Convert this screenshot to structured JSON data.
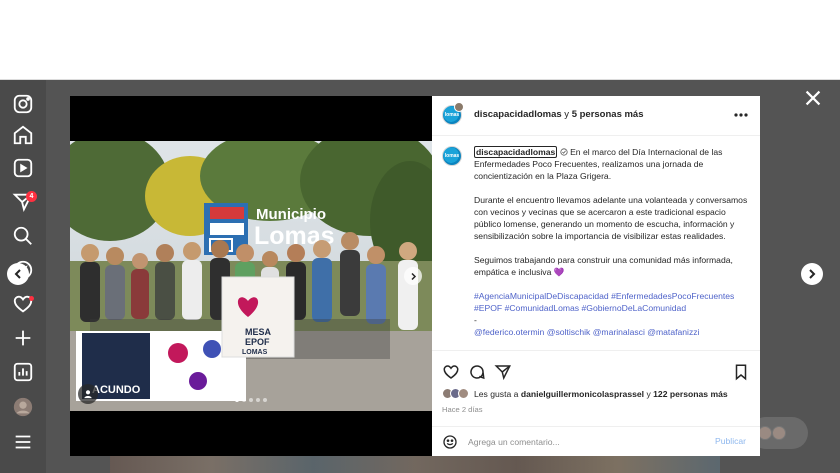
{
  "post": {
    "author": "discapacidadlomas",
    "header_and": "y",
    "header_others": "5 personas más",
    "avatar_text": "lomas",
    "caption_user": "discapacidadlomas",
    "caption_paragraphs": [
      "En el marco del Día Internacional de las Enfermedades Poco Frecuentes, realizamos una jornada de concientización en la Plaza Grigera.",
      "Durante el encuentro llevamos adelante una volanteada y conversamos con vecinos y vecinas que se acercaron a este tradicional espacio público lomense, generando un momento de escucha, información y sensibilización sobre la importancia de visibilizar estas realidades.",
      "Seguimos trabajando para construir una comunidad más informada, empática e inclusiva"
    ],
    "caption_heart": "💜",
    "hashtags": "#AgenciaMunicipalDeDiscapacidad #EnfermedadesPocoFrecuentes #EPOF #ComunidadLomas #GobiernoDeLaComunidad",
    "dash": "-",
    "tagged_partial": "@federico.otermin @soltischik @marinalasci @matafanizzi"
  },
  "likes": {
    "prefix": "Les gusta a",
    "user": "danielguillermonicolasprassel",
    "and": "y",
    "others": "122 personas más"
  },
  "timestamp": "Hace 2 días",
  "comment": {
    "placeholder": "Agrega un comentario...",
    "post_label": "Publicar"
  },
  "photo_signs": {
    "sign_municipio": "Municipio",
    "sign_lomas": "Lomas",
    "banner_mesa": "MESA",
    "banner_epof": "EPOF",
    "banner_lomas": "LOMAS",
    "banner_acundo": "ACUNDO"
  },
  "notifications_count": "4",
  "colors": {
    "hashtag": "#4f63c9",
    "post_button": "#8fb8ee",
    "badge": "#ff3040"
  },
  "icons": {
    "nav": [
      "instagram-icon",
      "home-icon",
      "reels-icon",
      "messages-icon",
      "search-icon",
      "explore-icon",
      "heart-icon",
      "create-icon",
      "dashboard-icon",
      "profile-icon",
      "menu-icon"
    ],
    "actions": [
      "like-icon",
      "comment-icon",
      "share-icon",
      "save-icon"
    ]
  }
}
